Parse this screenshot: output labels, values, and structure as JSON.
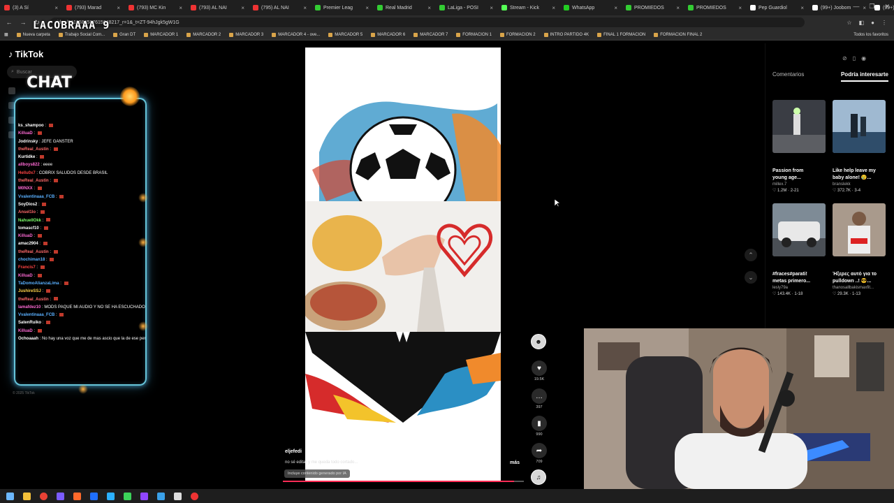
{
  "browser": {
    "tabs": [
      {
        "label": "(3) A Sí",
        "color": "#e33"
      },
      {
        "label": "(793) Marad",
        "color": "#e33"
      },
      {
        "label": "(793) MC Kin",
        "color": "#e33"
      },
      {
        "label": "(793) AL NAI",
        "color": "#e33"
      },
      {
        "label": "(795) AL NAI",
        "color": "#e33"
      },
      {
        "label": "Premier Leag",
        "color": "#3c3"
      },
      {
        "label": "Real Madrid",
        "color": "#3c3"
      },
      {
        "label": "LaLiga - POSI",
        "color": "#3c3"
      },
      {
        "label": "Stream - Kick",
        "color": "#5f5"
      },
      {
        "label": "WhatsApp",
        "color": "#2c2"
      },
      {
        "label": "PROMIEDOS",
        "color": "#3c3"
      },
      {
        "label": "PROMIEDOS",
        "color": "#3c3"
      },
      {
        "label": "Pep Guardiol",
        "color": "#fff"
      },
      {
        "label": "(99+) Joobom",
        "color": "#fff"
      },
      {
        "label": "(99+) Pedrit",
        "color": "#fff"
      },
      {
        "label": "(99+) Jue",
        "color": "#fff"
      }
    ],
    "new_tab": "+",
    "window_controls": [
      "—",
      "❐",
      "✕"
    ],
    "url": "ideo/7616586587615648217_r=1&_t=ZT-94hJgk5gW1G",
    "bookmarks": [
      "Nueva carpeta",
      "Trabajo Social Com...",
      "Gran DT",
      "MARCADOR 1",
      "MARCADOR 2",
      "MARCADOR 3",
      "MARCADOR 4 - ove...",
      "MARCADOR 5",
      "MARCADOR 6",
      "MARCADOR 7",
      "FORMACION 1",
      "FORMACION 2",
      "INTRO PARTIDO 4K",
      "FINAL 1 FORMACION",
      "FORMACION FINAL 2"
    ],
    "bookmarks_right": "Todos los favoritos"
  },
  "overlay": {
    "title": "LACOBRAAA 9",
    "chat_label": "CHAT",
    "chat_footer": "© 2025 TikTok"
  },
  "tiktok": {
    "logo": "TikTok",
    "search_placeholder": "Buscar"
  },
  "chat": [
    {
      "user": "ks_shampoo",
      "msg": "",
      "color": "#fff"
    },
    {
      "user": "KilluaD",
      "msg": "",
      "color": "#ff6ad5"
    },
    {
      "user": "Jodrinsky",
      "msg": "JEFE GANSTER",
      "color": "#fff"
    },
    {
      "user": "theReal_Austin",
      "msg": "",
      "color": "#ff6a6a"
    },
    {
      "user": "Kurtidke",
      "msg": "",
      "color": "#fff"
    },
    {
      "user": "allboys822",
      "msg": "eeee",
      "color": "#ff6ad5"
    },
    {
      "user": "Hellu0x7",
      "msg": "COBRIX SALUDOS DESDE BRASIL",
      "color": "#ff4444"
    },
    {
      "user": "theReal_Austin",
      "msg": "",
      "color": "#ff6a6a"
    },
    {
      "user": "M0NXX",
      "msg": "",
      "color": "#ff6ad5"
    },
    {
      "user": "Vvalentinaaa_FCB",
      "msg": "",
      "color": "#5ab0ff"
    },
    {
      "user": "SoyDios2",
      "msg": "",
      "color": "#fff"
    },
    {
      "user": "Ansel1lo",
      "msg": "",
      "color": "#ff6a6a"
    },
    {
      "user": "NahuelIOkk",
      "msg": "",
      "color": "#7cff6a"
    },
    {
      "user": "tomascf10",
      "msg": "",
      "color": "#fff"
    },
    {
      "user": "KilluaD",
      "msg": "",
      "color": "#ff6ad5"
    },
    {
      "user": "amac2904",
      "msg": "",
      "color": "#fff"
    },
    {
      "user": "theReal_Austin",
      "msg": "",
      "color": "#ff6a6a"
    },
    {
      "user": "chochiman18",
      "msg": "",
      "color": "#5ab0ff"
    },
    {
      "user": "Francis7",
      "msg": "",
      "color": "#ff4444"
    },
    {
      "user": "KilluaD",
      "msg": "",
      "color": "#ff6ad5"
    },
    {
      "user": "TaDomoAlianzaLima",
      "msg": "",
      "color": "#5ab0ff"
    },
    {
      "user": "JushireSSJ",
      "msg": "",
      "color": "#ffd34a"
    },
    {
      "user": "theReal_Austin",
      "msg": "",
      "color": "#ff6a6a"
    },
    {
      "user": "lamafdez10",
      "msg": "MODS PAQUE MI AUDIO Y NO SE HA ESCUCHADO, MOODDS",
      "color": "#ff6ad5"
    },
    {
      "user": "Vvalentinaaa_FCB",
      "msg": "",
      "color": "#5ab0ff"
    },
    {
      "user": "SatenRuiko",
      "msg": "",
      "color": "#fff"
    },
    {
      "user": "KilluaD",
      "msg": "",
      "color": "#ff6ad5"
    },
    {
      "user": "Ochoaaah",
      "msg": "No hay una voz que me de mas ascio que la de ese peruano ********",
      "color": "#fff"
    }
  ],
  "video": {
    "username": "eljefedi",
    "username_dim": "",
    "description": "no sé editar y me queda todo cortado...",
    "more": "más",
    "ai_badge": "Incluye contenido generado por IA",
    "progress": 0.96,
    "likes": "19.5K",
    "comments": "397",
    "saves": "990",
    "shares": "709"
  },
  "right_panel": {
    "tab_comments": "Comentarios",
    "tab_interesting": "Podría interesarte",
    "cards": [
      {
        "title": "Passion from",
        "title2": "young age...",
        "user": "millex.7",
        "stats": "♡ 1.2M · 2-21"
      },
      {
        "title": "Like help leave my",
        "title2": "baby alone! 😢...",
        "user": "branslekk",
        "stats": "♡ 372.7K · 3-4"
      },
      {
        "title": "#fraces#parati!",
        "title2": "metas primero...",
        "user": "lesly79a",
        "stats": "♡ 143.4K · 1-18"
      },
      {
        "title": "Ήξερες αυτό για το",
        "title2": "pulldown ..! 😎...",
        "user": "thanosallbakismaxfit...",
        "stats": "♡ 29.3K · 1-13"
      }
    ]
  }
}
